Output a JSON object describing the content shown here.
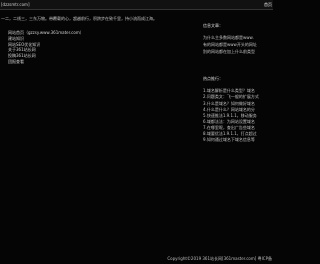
{
  "header": {
    "site_url": "[dzzsmtr.com]",
    "home_link": "首页"
  },
  "slogan": "一二，二线三，三东万物。带覆载的心，超越前行，积跻步在致千里，持小流而成江海。",
  "nav_items": [
    "网站首页（gzzsy.www.361mater.com）",
    "建站知识",
    "网站SEO优化知识",
    "关于361站长网",
    "投稿361站长网",
    "团报查看"
  ],
  "sidebar": {
    "intro_title": "信息文章：",
    "intro_lines": [
      "为什么主多数网站都是www.",
      "有的网站都是www开头的网址",
      "别的网站都在加上什么前类型"
    ],
    "recommend_title": "热点推行：",
    "recommend_items": [
      "1.域名解析是什么类型？域名",
      "2.问题类文：飞一般的扩展方式",
      "3.什么是域名？如何做好域名",
      "4.什么是什么？网站域名的分",
      "5.快速推法1.9.1.1，移动服务",
      "6.域都法法：为网站设置域名",
      "7.在哪里呢，查出广告些域名",
      "8.域要优法1.9.1.1，打点超过",
      "9.如何通过域名下域名信息等"
    ]
  },
  "footer": "Copyright©2019 361站长网[361master.com] 粤ICP备"
}
